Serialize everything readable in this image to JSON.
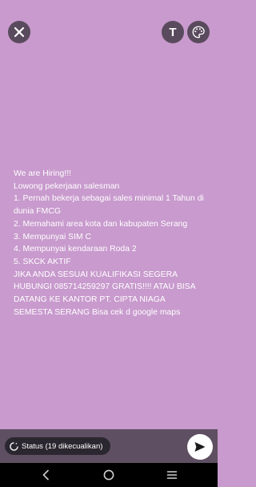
{
  "toolbar": {
    "close_icon": "close-icon",
    "text_tool_label": "T",
    "palette_icon": "palette-icon"
  },
  "status": {
    "text": "We are Hiring!!!\nLowong pekerjaan salesman\n1. Pernah bekerja sebagai sales minimal 1 Tahun di dunia FMCG\n2. Memahami area kota dan kabupaten Serang\n3. Mempunyai SIM C\n4. Mempunyai kendaraan Roda 2\n5. SKCK AKTIF\nJIKA ANDA SESUAI KUALIFIKASI SEGERA HUBUNGI 085714259297 GRATIS!!!! ATAU BISA DATANG KE KANTOR PT. CIPTA NIAGA SEMESTA SERANG Bisa cek d google maps"
  },
  "footer": {
    "audience_label": "Status (19 dikecualikan)",
    "send_icon": "send-icon"
  },
  "colors": {
    "background": "#c89acd",
    "panel": "#5f4f62",
    "button": "#5a4a5d"
  }
}
